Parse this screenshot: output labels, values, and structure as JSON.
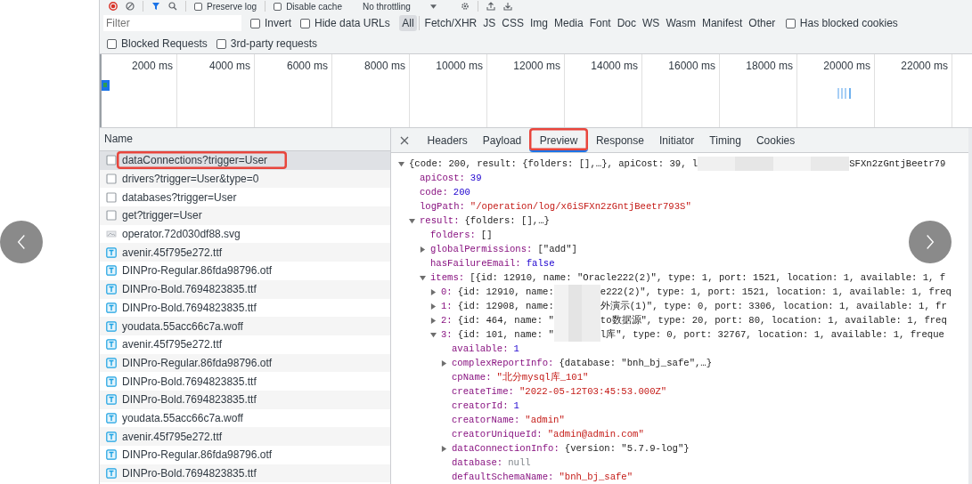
{
  "toolbar": {
    "preserve_log": {
      "label": "Preserve log",
      "checked": false
    },
    "disable_cache": {
      "label": "Disable cache",
      "checked": false
    },
    "throttling": "No throttling"
  },
  "filter": {
    "placeholder": "Filter",
    "invert": {
      "label": "Invert",
      "checked": false
    },
    "hide_data_urls": {
      "label": "Hide data URLs",
      "checked": false
    },
    "types": [
      {
        "label": "All",
        "selected": true
      },
      {
        "label": "Fetch/XHR",
        "selected": false
      },
      {
        "label": "JS",
        "selected": false
      },
      {
        "label": "CSS",
        "selected": false
      },
      {
        "label": "Img",
        "selected": false
      },
      {
        "label": "Media",
        "selected": false
      },
      {
        "label": "Font",
        "selected": false
      },
      {
        "label": "Doc",
        "selected": false
      },
      {
        "label": "WS",
        "selected": false
      },
      {
        "label": "Wasm",
        "selected": false
      },
      {
        "label": "Manifest",
        "selected": false
      },
      {
        "label": "Other",
        "selected": false
      }
    ],
    "has_blocked_cookies": {
      "label": "Has blocked cookies",
      "checked": false
    },
    "blocked_requests": {
      "label": "Blocked Requests",
      "checked": false
    },
    "third_party": {
      "label": "3rd-party requests",
      "checked": false
    }
  },
  "overview": {
    "ticks": [
      "2000 ms",
      "4000 ms",
      "6000 ms",
      "8000 ms",
      "10000 ms",
      "12000 ms",
      "14000 ms",
      "16000 ms",
      "18000 ms",
      "20000 ms",
      "22000 ms"
    ]
  },
  "requests": {
    "header": "Name",
    "rows": [
      {
        "name": "dataConnections?trigger=User",
        "kind": "xhr",
        "selected": true,
        "highlighted": true
      },
      {
        "name": "drivers?trigger=User&type=0",
        "kind": "xhr",
        "selected": false,
        "highlighted": false
      },
      {
        "name": "databases?trigger=User",
        "kind": "xhr",
        "selected": false,
        "highlighted": false
      },
      {
        "name": "get?trigger=User",
        "kind": "xhr",
        "selected": false,
        "highlighted": false
      },
      {
        "name": "operator.72d030df88.svg",
        "kind": "image",
        "selected": false,
        "highlighted": false
      },
      {
        "name": "avenir.45f795e272.ttf",
        "kind": "font",
        "selected": false,
        "highlighted": false
      },
      {
        "name": "DINPro-Regular.86fda98796.otf",
        "kind": "font",
        "selected": false,
        "highlighted": false
      },
      {
        "name": "DINPro-Bold.7694823835.ttf",
        "kind": "font",
        "selected": false,
        "highlighted": false
      },
      {
        "name": "DINPro-Bold.7694823835.ttf",
        "kind": "font",
        "selected": false,
        "highlighted": false
      },
      {
        "name": "youdata.55acc66c7a.woff",
        "kind": "font",
        "selected": false,
        "highlighted": false
      },
      {
        "name": "avenir.45f795e272.ttf",
        "kind": "font",
        "selected": false,
        "highlighted": false
      },
      {
        "name": "DINPro-Regular.86fda98796.otf",
        "kind": "font",
        "selected": false,
        "highlighted": false
      },
      {
        "name": "DINPro-Bold.7694823835.ttf",
        "kind": "font",
        "selected": false,
        "highlighted": false
      },
      {
        "name": "DINPro-Bold.7694823835.ttf",
        "kind": "font",
        "selected": false,
        "highlighted": false
      },
      {
        "name": "youdata.55acc66c7a.woff",
        "kind": "font",
        "selected": false,
        "highlighted": false
      },
      {
        "name": "avenir.45f795e272.ttf",
        "kind": "font",
        "selected": false,
        "highlighted": false
      },
      {
        "name": "DINPro-Regular.86fda98796.otf",
        "kind": "font",
        "selected": false,
        "highlighted": false
      },
      {
        "name": "DINPro-Bold.7694823835.ttf",
        "kind": "font",
        "selected": false,
        "highlighted": false
      }
    ]
  },
  "details": {
    "tabs": [
      {
        "label": "Headers",
        "selected": false,
        "highlighted": false
      },
      {
        "label": "Payload",
        "selected": false,
        "highlighted": false
      },
      {
        "label": "Preview",
        "selected": true,
        "highlighted": true
      },
      {
        "label": "Response",
        "selected": false,
        "highlighted": false
      },
      {
        "label": "Initiator",
        "selected": false,
        "highlighted": false
      },
      {
        "label": "Timing",
        "selected": false,
        "highlighted": false
      },
      {
        "label": "Cookies",
        "selected": false,
        "highlighted": false
      }
    ],
    "preview": {
      "kind": "split",
      "value": "{code: 200, result: {folders: [],…}, apiCost: 39, l",
      "value_after": "SFXn2zGntjBeetr79",
      "expanded": true,
      "children": [
        {
          "key": "apiCost:",
          "value": "39",
          "kind": "number"
        },
        {
          "key": "code:",
          "value": "200",
          "kind": "number"
        },
        {
          "key": "logPath:",
          "value": "\"/operation/log/x6iSFXn2zGntjBeetr793S\"",
          "kind": "string"
        },
        {
          "key": "result:",
          "value": "{folders: [],…}",
          "kind": "object",
          "expanded": true,
          "children": [
            {
              "key": "folders:",
              "value": "[]",
              "kind": "object"
            },
            {
              "key": "globalPermissions:",
              "value": "[\"add\"]",
              "kind": "object",
              "expanded": false
            },
            {
              "key": "hasFailureEmail:",
              "value": "false",
              "kind": "boolean"
            },
            {
              "key": "items:",
              "value": "[{id: 12910, name: \"Oracle222(2)\", type: 1, port: 1521, location: 1, available: 1, f",
              "kind": "object",
              "expanded": true,
              "children": [
                {
                  "key": "0:",
                  "value": "{id: 12910, name:",
                  "value_after": "e222(2)\", type: 1, port: 1521, location: 1, available: 1, freq",
                  "kind": "split",
                  "expanded": false
                },
                {
                  "key": "1:",
                  "value": "{id: 12908, name:",
                  "value_after": "外演示(1)\", type: 0, port: 3306, location: 1, available: 1, fr",
                  "kind": "split",
                  "expanded": false
                },
                {
                  "key": "2:",
                  "value": "{id: 464, name: \"",
                  "value_after": "to数据源\", type: 20, port: 80, location: 1, available: 1, freq",
                  "kind": "split",
                  "expanded": false
                },
                {
                  "key": "3:",
                  "value": "{id: 101, name: \"",
                  "value_after": "l库\", type: 0, port: 32767, location: 1, available: 1, freque",
                  "kind": "split",
                  "expanded": true,
                  "children": [
                    {
                      "key": "available:",
                      "value": "1",
                      "kind": "number"
                    },
                    {
                      "key": "complexReportInfo:",
                      "value": "{database: \"bnh_bj_safe\",…}",
                      "kind": "object",
                      "expanded": false
                    },
                    {
                      "key": "cpName:",
                      "value": "\"北分mysql库_101\"",
                      "kind": "string"
                    },
                    {
                      "key": "createTime:",
                      "value": "\"2022-05-12T03:45:53.000Z\"",
                      "kind": "string"
                    },
                    {
                      "key": "creatorId:",
                      "value": "1",
                      "kind": "number"
                    },
                    {
                      "key": "creatorName:",
                      "value": "\"admin\"",
                      "kind": "string"
                    },
                    {
                      "key": "creatorUniqueId:",
                      "value": "\"admin@admin.com\"",
                      "kind": "string"
                    },
                    {
                      "key": "dataConnectionInfo:",
                      "value": "{version: \"5.7.9-log\"}",
                      "kind": "object",
                      "expanded": false
                    },
                    {
                      "key": "database:",
                      "value": "null",
                      "kind": "null"
                    },
                    {
                      "key": "defaultSchemaName:",
                      "value": "\"bnh_bj_safe\"",
                      "kind": "string"
                    }
                  ]
                }
              ]
            }
          ]
        }
      ]
    }
  }
}
